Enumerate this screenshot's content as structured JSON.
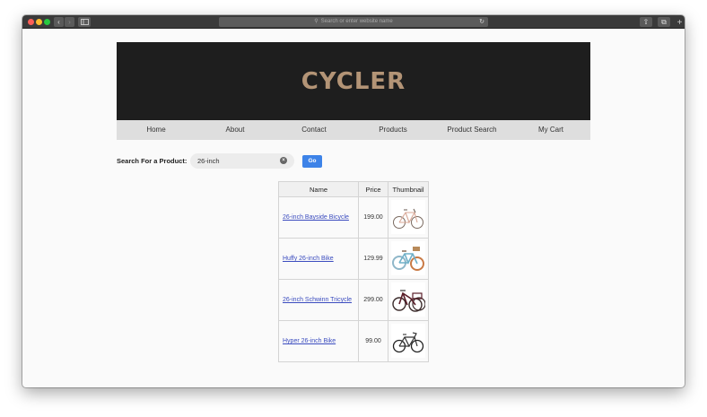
{
  "browser": {
    "address_placeholder": "Search or enter website name",
    "icons": [
      "back-icon",
      "forward-icon",
      "sidebar-icon",
      "search-icon",
      "reload-icon",
      "share-icon",
      "tabs-icon",
      "plus-icon"
    ]
  },
  "site": {
    "logo": "CYCLER",
    "colors": {
      "header_bg": "#1e1e1e",
      "logo": "#b39476",
      "nav_bg": "#dedede",
      "go_button": "#3d83e8",
      "link": "#3b4cbf"
    }
  },
  "nav": {
    "items": [
      "Home",
      "About",
      "Contact",
      "Products",
      "Product Search",
      "My Cart"
    ]
  },
  "search": {
    "label": "Search For a Product:",
    "value": "26-inch",
    "button": "Go"
  },
  "table": {
    "headers": [
      "Name",
      "Price",
      "Thumbnail"
    ],
    "rows": [
      {
        "name": "26-inch Bayside Bicycle",
        "price": "199.00",
        "thumb": "cruiser-bicycle-thumbnail"
      },
      {
        "name": "Huffy 26-inch Bike",
        "price": "129.99",
        "thumb": "blue-cruiser-bike-thumbnail"
      },
      {
        "name": "26-inch Schwinn Tricycle",
        "price": "299.00",
        "thumb": "tricycle-thumbnail"
      },
      {
        "name": "Hyper 26-inch Bike",
        "price": "99.00",
        "thumb": "black-cruiser-bike-thumbnail"
      }
    ]
  }
}
